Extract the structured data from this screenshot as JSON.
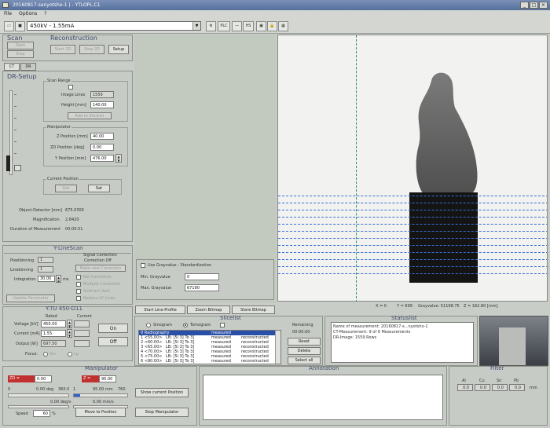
{
  "window": {
    "title": "20160817-sanyotsho-1  |  - YTLOPL.C1"
  },
  "menu": [
    "File",
    "Options",
    "?"
  ],
  "toolbar": {
    "preset": "450kV - 1.55mA",
    "btn_plc": "PLC",
    "btn_hs": "HS"
  },
  "scan": {
    "title": "Scan",
    "start": "Start",
    "stop": "Stop"
  },
  "reconstruction": {
    "title": "Reconstruction",
    "start2d": "Start 2D",
    "stop2d": "Stop 2D",
    "setup": "Setup"
  },
  "tabs": [
    "CT",
    "DR"
  ],
  "drsetup": {
    "title": "DR-Setup",
    "scan_range": "Scan Range",
    "image_lines_label": "Image Lines",
    "image_lines": "1559",
    "height_label": "Height [mm]",
    "height": "140.00",
    "add_slicelist": "Add to Slicelist",
    "manipulator": "Manipulator",
    "z_label": "Z Position [mm]",
    "z": "40.00",
    "zd_label": "ZD Position [deg]",
    "zd": "0.00",
    "y_label": "Y Position [mm]",
    "y": "476.00",
    "current_position": "Current Position",
    "get": "Get",
    "set": "Set",
    "obj_det_label": "Object-Detector [mm]",
    "obj_det": "675.0300",
    "mag_label": "Magnification",
    "mag": "2.8420",
    "dur_label": "Duration of Measurement",
    "dur": "00:00:51"
  },
  "linescan": {
    "title": "Y-LineScan",
    "pixelbinning_label": "Pixelbinning",
    "pixelbinning": "1",
    "linebinning_label": "Linebinning",
    "linebinning": "1",
    "integration_label": "Integration",
    "integration": "30.00",
    "ms": "ms",
    "update": "Update Parameter",
    "signal_title": "Signal Correction",
    "correction_off": "Correction Off",
    "make_new": "Make new Correction",
    "opt1": "Rot Correction",
    "opt2": "Multiple Correction",
    "opt3": "Subtract dark",
    "opt4": "Reduce LP Lines"
  },
  "gray": {
    "use_label": "Use Grayvalue - Standardization",
    "min_label": "Min. Grayvalue",
    "min": "0",
    "max_label": "Max. Grayvalue",
    "max": "67190"
  },
  "xray": {
    "title": "Y.TU 450-D11",
    "rated": "Rated",
    "current": "Current",
    "voltage_label": "Voltage [kV]",
    "voltage": "450.00",
    "current_label": "Current [mA]",
    "current_val": "1.55",
    "output_label": "Output [W]",
    "output": "697.50",
    "focus_label": "Focus:",
    "focus1": "Sm",
    "focus2": "Lg",
    "on": "On",
    "off": "Off"
  },
  "actions": {
    "line_profile": "Start Line-Profile",
    "zoom": "Zoom Bitmap",
    "store": "Store Bitmap"
  },
  "slicelist": {
    "title": "Slicelist",
    "sinogram": "Sinogram",
    "tomogram": "Tomogram",
    "remaining_label": "Remaining",
    "remaining": "00:00:00",
    "reset": "Reset",
    "delete": "Delete",
    "select_all": "Select all",
    "rows": [
      {
        "name": "0 Radiography",
        "lb": "",
        "state": "measured",
        "recon": ""
      },
      {
        "name": "1 <55.00>",
        "lb": "LB: [5i 3] To 3]",
        "state": "measured",
        "recon": "reconstructed"
      },
      {
        "name": "2 <60.00>",
        "lb": "LB: [5i 3] To 3]",
        "state": "measured",
        "recon": "reconstructed"
      },
      {
        "name": "3 <65.00>",
        "lb": "LB: [5i 3] To 3]",
        "state": "measured",
        "recon": "reconstructed"
      },
      {
        "name": "4 <70.00>",
        "lb": "LB: [5i 3] To 3]",
        "state": "measured",
        "recon": "reconstructed"
      },
      {
        "name": "5 <75.00>",
        "lb": "LB: [5i 3] To 3]",
        "state": "measured",
        "recon": "reconstructed"
      },
      {
        "name": "6 <80.00>",
        "lb": "LB: [5i 3] To 3]",
        "state": "measured",
        "recon": "reconstructed"
      }
    ]
  },
  "statuslist": {
    "title": "Statuslist",
    "line1": "Name of measurement: 20160817-s...nyotsho-1",
    "line2": "CT-Measurement:  9 of 9 Measurements",
    "line3": "DR-Image:  1559  Rows"
  },
  "image_status": {
    "x": "X = 0",
    "y": "Y = 699",
    "gray": "Grayvalue: 51198.75",
    "z": "Z = 162.80  [mm]"
  },
  "manipulator": {
    "title": "Manipulator",
    "zd_label": "ZD =",
    "zd": "0.00",
    "z_label": "Z =",
    "z": "95.00",
    "zd_min": "0",
    "zd_cur": "0.00 deg",
    "zd_max": "360.0",
    "z_min": "1",
    "z_cur": "95.00 mm",
    "z_max": "760",
    "zd_speed": "0.00 deg/s",
    "z_speed": "0.00 mm/s",
    "speed_label": "Speed",
    "speed": "60",
    "pct": "%",
    "move": "Move to Position",
    "show": "Show current Position",
    "stop": "Stop Manipulator"
  },
  "annotation": {
    "title": "Annotation"
  },
  "filter": {
    "title": "Filter",
    "cols": [
      "Al",
      "Cu",
      "Sn",
      "Pb"
    ],
    "vals": [
      "0.0",
      "0.0",
      "0.0",
      "0.0"
    ],
    "unit": "mm"
  },
  "colors": {
    "scan_line": "#3a6fd8",
    "title_bar": "#56709c"
  }
}
